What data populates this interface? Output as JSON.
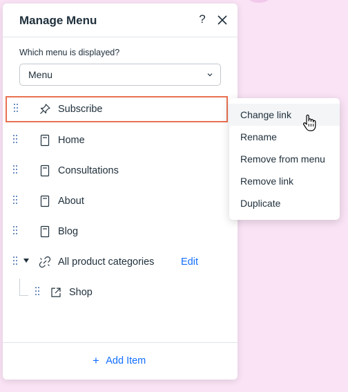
{
  "panel": {
    "title": "Manage Menu",
    "help_label": "?",
    "field_label": "Which menu is displayed?",
    "selected_menu": "Menu"
  },
  "items": [
    {
      "label": "Subscribe",
      "icon": "pin-icon",
      "selected": true
    },
    {
      "label": "Home",
      "icon": "page-icon"
    },
    {
      "label": "Consultations",
      "icon": "page-icon"
    },
    {
      "label": "About",
      "icon": "page-icon"
    },
    {
      "label": "Blog",
      "icon": "page-icon"
    },
    {
      "label": "All product categories",
      "icon": "dynamic-link-icon",
      "action": "Edit",
      "expanded": true
    },
    {
      "label": "Shop",
      "icon": "external-link-icon",
      "child": true
    }
  ],
  "footer": {
    "add_label": "Add Item"
  },
  "context_menu": {
    "items": [
      "Change link",
      "Rename",
      "Remove from menu",
      "Remove link",
      "Duplicate"
    ],
    "hovered": "Change link"
  },
  "colors": {
    "accent": "#116dff",
    "selection_border": "#e8704f",
    "background": "#f9e3f5"
  }
}
